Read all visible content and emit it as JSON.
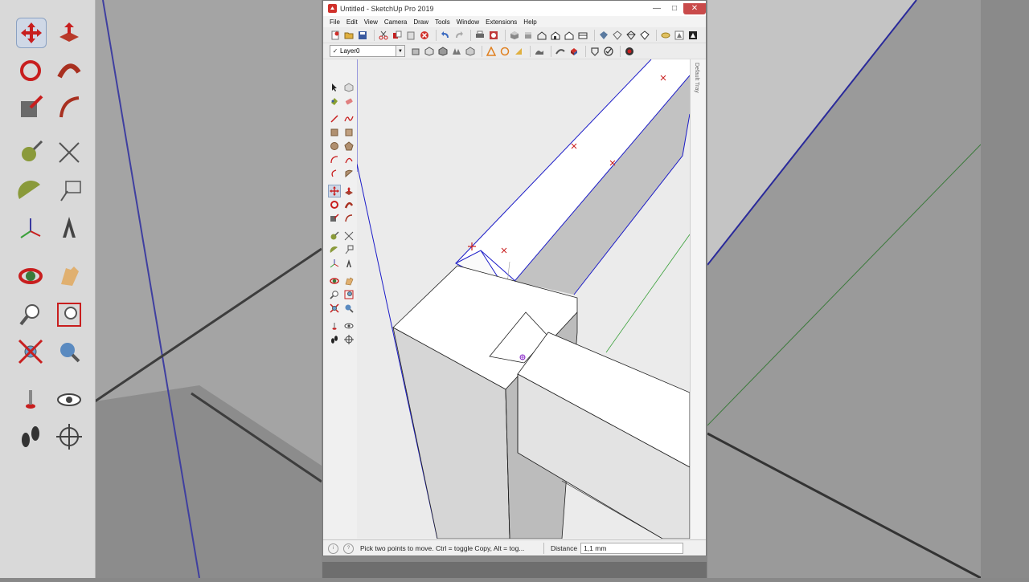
{
  "window": {
    "title": "Untitled - SketchUp Pro 2019",
    "minimize_glyph": "—",
    "maximize_glyph": "□",
    "close_glyph": "✕"
  },
  "menu": {
    "items": [
      "File",
      "Edit",
      "View",
      "Camera",
      "Draw",
      "Tools",
      "Window",
      "Extensions",
      "Help"
    ]
  },
  "layer": {
    "current": "Layer0"
  },
  "tray": {
    "label": "Default Tray"
  },
  "statusbar": {
    "message": "Pick two points to move.  Ctrl = toggle Copy, Alt = tog...",
    "measurement_label": "Distance",
    "measurement_value": "1,1 mm",
    "info_icon": "i",
    "help_icon": "?"
  },
  "colors": {
    "selection_blue": "#1c1cc8",
    "axis_red": "#c81e1e",
    "axis_green": "#3aa03a",
    "close_red": "#c94a4a"
  },
  "icons": {
    "toolbar_row1": [
      "new-icon",
      "open-icon",
      "save-icon",
      "cut-icon",
      "copy-icon",
      "paste-icon",
      "erase-icon",
      "undo-icon",
      "redo-icon",
      "print-icon",
      "model-info-icon",
      "iso-view-icon",
      "top-view-icon",
      "front-view-icon",
      "right-view-icon",
      "back-view-icon",
      "left-view-icon",
      "bottom-view-icon",
      "xray-icon",
      "back-edges-icon",
      "wireframe-icon",
      "hidden-line-icon",
      "shaded-icon",
      "shaded-textures-icon",
      "monochrome-icon"
    ],
    "toolbar_row2": [
      "section-plane-icon",
      "display-section-planes-icon",
      "display-section-cuts-icon",
      "section-fill-icon",
      "warehouse-icon",
      "extension-warehouse-icon",
      "layout-icon",
      "add-location-icon",
      "toggle-terrain-icon",
      "photo-texture-icon",
      "extension-manager-icon",
      "styles-icon",
      "scenes-icon"
    ]
  }
}
